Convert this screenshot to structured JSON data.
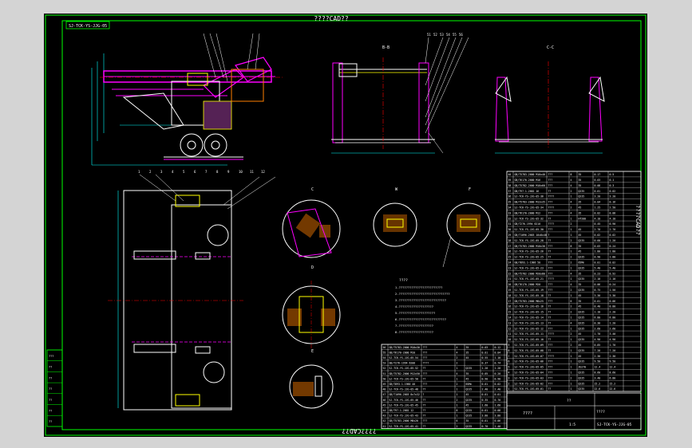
{
  "title_top": "????CAD??",
  "title_bottom": "????CAD??",
  "drawing_number_box": "SJ-TCK-YS-JJG-05",
  "view_label_1": "B-B",
  "view_label_2": "C-C",
  "detail_labels": [
    "C",
    "W",
    "F",
    "D",
    "E"
  ],
  "notes_title": "????",
  "notes_lines": [
    "1.????????????????????????",
    "2.????????????????????????????",
    "3.??????????????????????????",
    "4.???????????????????",
    "5.????????????????????",
    "6.??????????????????????????",
    "7.???????????????????",
    "8.???????????????????"
  ],
  "right_bom_rows": [
    [
      "40",
      "GB/T5783-2000 M16x40",
      "???",
      "8",
      "35",
      "0.17",
      "0.5"
    ],
    [
      "39",
      "GB/T6170-2000 M16",
      "???",
      "4",
      "35",
      "0.03",
      "0.1"
    ],
    [
      "38",
      "GB/T5782-2000 M16x60",
      "???",
      "4",
      "35",
      "0.08",
      "0.3"
    ],
    [
      "37",
      "GB/T97.1-2002 16",
      "??",
      "2",
      "Q235",
      "0.01",
      "0.02"
    ],
    [
      "36",
      "SJ-TCK-YS-JJG-05-36",
      "????",
      "1",
      "Q235",
      "3.20",
      "3.20"
    ],
    [
      "35",
      "GB/T5783-2000 M12x35",
      "???",
      "4",
      "35",
      "0.04",
      "0.16"
    ],
    [
      "34",
      "SJ-TCK-YS-JJG-05-34",
      "????",
      "2",
      "45",
      "1.25",
      "2.50"
    ],
    [
      "33",
      "GB/T6170-2000 M12",
      "???",
      "4",
      "35",
      "0.02",
      "0.08"
    ],
    [
      "32",
      "SJ-TCK-YS-JJG-05-32",
      "??",
      "1",
      "HT200",
      "4.10",
      "4.10"
    ],
    [
      "31",
      "GB/T276-1994 6210",
      "????",
      "2",
      "",
      "0.45",
      "0.90"
    ],
    [
      "30",
      "SJ-TCK-YS-JJG-05-30",
      "???",
      "1",
      "45",
      "2.70",
      "2.70"
    ],
    [
      "29",
      "GB/T1096-2003 10x8x40",
      "?",
      "1",
      "45",
      "0.02",
      "0.02"
    ],
    [
      "28",
      "SJ-TCK-YS-JJG-05-28",
      "??",
      "2",
      "Q235",
      "0.60",
      "1.20"
    ],
    [
      "27",
      "GB/T5783-2000 M10x30",
      "???",
      "8",
      "35",
      "0.03",
      "0.24"
    ],
    [
      "26",
      "SJ-TCK-YS-JJG-05-26",
      "??",
      "1",
      "45",
      "1.80",
      "1.80"
    ],
    [
      "25",
      "SJ-TCK-YS-JJG-05-25",
      "??",
      "2",
      "Q235",
      "0.90",
      "1.80"
    ],
    [
      "24",
      "GB/T893.1-1986 50",
      "???",
      "2",
      "65Mn",
      "0.01",
      "0.02"
    ],
    [
      "23",
      "SJ-TCK-YS-JJG-05-23",
      "???",
      "1",
      "Q235",
      "5.40",
      "5.40"
    ],
    [
      "22",
      "GB/T5782-2000 M20x80",
      "???",
      "4",
      "35",
      "0.23",
      "0.92"
    ],
    [
      "21",
      "SJ-TCK-YS-JJG-05-21",
      "????",
      "1",
      "Q235",
      "2.10",
      "2.10"
    ],
    [
      "20",
      "GB/T6170-2000 M20",
      "???",
      "4",
      "35",
      "0.06",
      "0.24"
    ],
    [
      "19",
      "SJ-TCK-YS-JJG-05-19",
      "???",
      "2",
      "Q235",
      "0.75",
      "1.50"
    ],
    [
      "18",
      "SJ-TCK-YS-JJG-05-18",
      "??",
      "1",
      "45",
      "3.30",
      "3.30"
    ],
    [
      "17",
      "GB/T5783-2000 M8x25",
      "???",
      "6",
      "35",
      "0.01",
      "0.06"
    ],
    [
      "16",
      "SJ-TCK-YS-JJG-05-16",
      "??",
      "2",
      "45",
      "0.40",
      "0.80"
    ],
    [
      "15",
      "SJ-TCK-YS-JJG-05-15",
      "??",
      "2",
      "Q235",
      "1.10",
      "2.20"
    ],
    [
      "14",
      "SJ-TCK-YS-JJG-05-14",
      "??",
      "1",
      "Q235",
      "6.80",
      "6.80"
    ],
    [
      "13",
      "SJ-TCK-YS-JJG-05-13",
      "??",
      "4",
      "Q235",
      "0.30",
      "1.20"
    ],
    [
      "12",
      "SJ-TCK-YS-JJG-05-12",
      "???",
      "1",
      "Q235",
      "2.60",
      "2.60"
    ],
    [
      "11",
      "SJ-TCK-YS-JJG-05-11",
      "????",
      "2",
      "45",
      "1.70",
      "3.40"
    ],
    [
      "10",
      "SJ-TCK-YS-JJG-05-10",
      "??",
      "1",
      "Q235",
      "4.90",
      "4.90"
    ],
    [
      "9",
      "SJ-TCK-YS-JJG-05-09",
      "???",
      "2",
      "45",
      "0.85",
      "1.70"
    ],
    [
      "8",
      "SJ-TCK-YS-JJG-05-08",
      "??",
      "1",
      "Q235",
      "7.20",
      "7.20"
    ],
    [
      "7",
      "SJ-TCK-YS-JJG-05-07",
      "????",
      "1",
      "45",
      "2.30",
      "2.30"
    ],
    [
      "6",
      "SJ-TCK-YS-JJG-05-06",
      "???",
      "1",
      "Q235",
      "9.50",
      "9.50"
    ],
    [
      "5",
      "SJ-TCK-YS-JJG-05-05",
      "???",
      "1",
      "ZG270",
      "12.4",
      "12.4"
    ],
    [
      "4",
      "SJ-TCK-YS-JJG-05-04",
      "???",
      "1",
      "Q235",
      "8.60",
      "8.60"
    ],
    [
      "3",
      "SJ-TCK-YS-JJG-05-03",
      "???",
      "2",
      "Q235",
      "3.40",
      "6.80"
    ],
    [
      "2",
      "SJ-TCK-YS-JJG-05-02",
      "???",
      "1",
      "Q235",
      "15.2",
      "15.2"
    ],
    [
      "1",
      "SJ-TCK-YS-JJG-05-01",
      "??",
      "1",
      "Q235",
      "22.6",
      "22.6"
    ]
  ],
  "left_bom_rows": [
    [
      "56",
      "GB/T5783-2000 M10x30",
      "???",
      "4",
      "35",
      "0.03",
      "0.12"
    ],
    [
      "55",
      "GB/T6170-2000 M10",
      "???",
      "4",
      "35",
      "0.01",
      "0.04"
    ],
    [
      "54",
      "SJ-TCK-YS-JJG-05-54",
      "???",
      "2",
      "45",
      "0.55",
      "1.10"
    ],
    [
      "53",
      "GB/T276-1994 6208",
      "????",
      "2",
      "",
      "0.37",
      "0.74"
    ],
    [
      "52",
      "SJ-TCK-YS-JJG-05-52",
      "??",
      "1",
      "Q235",
      "1.20",
      "1.20"
    ],
    [
      "51",
      "GB/T5782-2000 M12x50",
      "???",
      "4",
      "35",
      "0.05",
      "0.20"
    ],
    [
      "50",
      "SJ-TCK-YS-JJG-05-50",
      "??",
      "1",
      "45",
      "0.90",
      "0.90"
    ],
    [
      "49",
      "GB/T893.1-1986 40",
      "???",
      "2",
      "65Mn",
      "0.01",
      "0.02"
    ],
    [
      "48",
      "SJ-TCK-YS-JJG-05-48",
      "??",
      "1",
      "Q235",
      "2.40",
      "2.40"
    ],
    [
      "47",
      "GB/T1096-2003 8x7x32",
      "?",
      "1",
      "45",
      "0.01",
      "0.01"
    ],
    [
      "46",
      "SJ-TCK-YS-JJG-05-46",
      "??",
      "2",
      "Q235",
      "0.35",
      "0.70"
    ],
    [
      "45",
      "SJ-TCK-YS-JJG-05-45",
      "??",
      "1",
      "45",
      "1.60",
      "1.60"
    ],
    [
      "44",
      "GB/T97.1-2002 12",
      "??",
      "8",
      "Q235",
      "0.01",
      "0.08"
    ],
    [
      "43",
      "SJ-TCK-YS-JJG-05-43",
      "??",
      "1",
      "Q235",
      "3.80",
      "3.80"
    ],
    [
      "42",
      "GB/T5783-2000 M8x20",
      "???",
      "6",
      "35",
      "0.01",
      "0.06"
    ],
    [
      "41",
      "SJ-TCK-YS-JJG-05-41",
      "??",
      "2",
      "Q235",
      "0.70",
      "1.40"
    ]
  ],
  "title_block": {
    "label_mark": "??",
    "label_scale": "????",
    "part_name": "????",
    "drawing_no": "SJ-TCK-YS-JJG-05",
    "scale_value": "1:5"
  },
  "left_margin_labels": [
    "???",
    "??",
    "??",
    "??",
    "??",
    "??",
    "??"
  ],
  "leader_numbers_top": [
    "51",
    "52",
    "53",
    "54",
    "55",
    "56"
  ],
  "leader_numbers_mid": [
    "1",
    "2",
    "3",
    "4",
    "5",
    "6",
    "7",
    "8",
    "9",
    "10",
    "11",
    "12"
  ],
  "colors": {
    "background": "#000000",
    "frame": "#00ff00",
    "part": "#ffffff",
    "highlight": "#ff00ff",
    "feature": "#ffff00",
    "centerline": "#ff0000",
    "dimension": "#00ffff",
    "section": "#ff7f00"
  }
}
